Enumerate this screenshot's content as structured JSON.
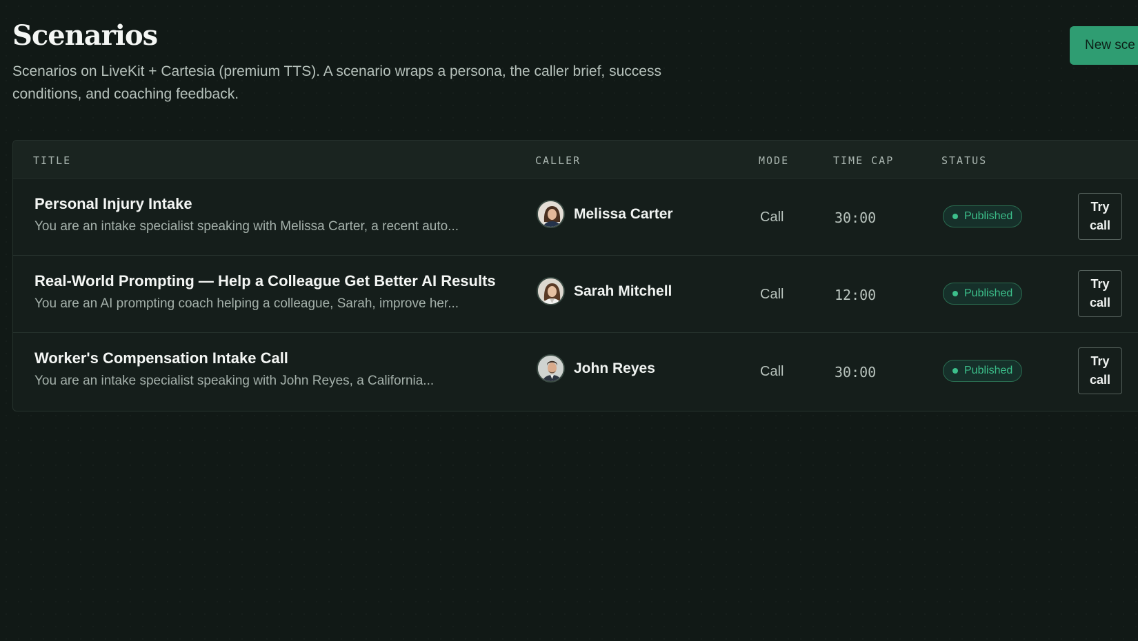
{
  "page": {
    "title": "Scenarios",
    "subtitle": "Scenarios on LiveKit + Cartesia (premium TTS). A scenario wraps a persona, the caller brief, success conditions, and coaching feedback.",
    "new_button_label": "New sce"
  },
  "table": {
    "headers": {
      "title": "TITLE",
      "caller": "CALLER",
      "mode": "MODE",
      "time_cap": "TIME CAP",
      "status": "STATUS"
    },
    "rows": [
      {
        "title": "Personal Injury Intake",
        "description": "You are an intake specialist speaking with Melissa Carter, a recent auto...",
        "caller": "Melissa Carter",
        "avatar": "female-avatar",
        "mode": "Call",
        "time_cap": "30:00",
        "status": "Published",
        "action": "Try call"
      },
      {
        "title": "Real-World Prompting — Help a Colleague Get Better AI Results",
        "description": "You are an AI prompting coach helping a colleague, Sarah, improve her...",
        "caller": "Sarah Mitchell",
        "avatar": "female-avatar",
        "mode": "Call",
        "time_cap": "12:00",
        "status": "Published",
        "action": "Try call"
      },
      {
        "title": "Worker's Compensation Intake Call",
        "description": "You are an intake specialist speaking with John Reyes, a California...",
        "caller": "John Reyes",
        "avatar": "male-avatar",
        "mode": "Call",
        "time_cap": "30:00",
        "status": "Published",
        "action": "Try call"
      }
    ]
  },
  "colors": {
    "background": "#111916",
    "accent": "#2f9d72",
    "status_green": "#3cbf8b"
  }
}
